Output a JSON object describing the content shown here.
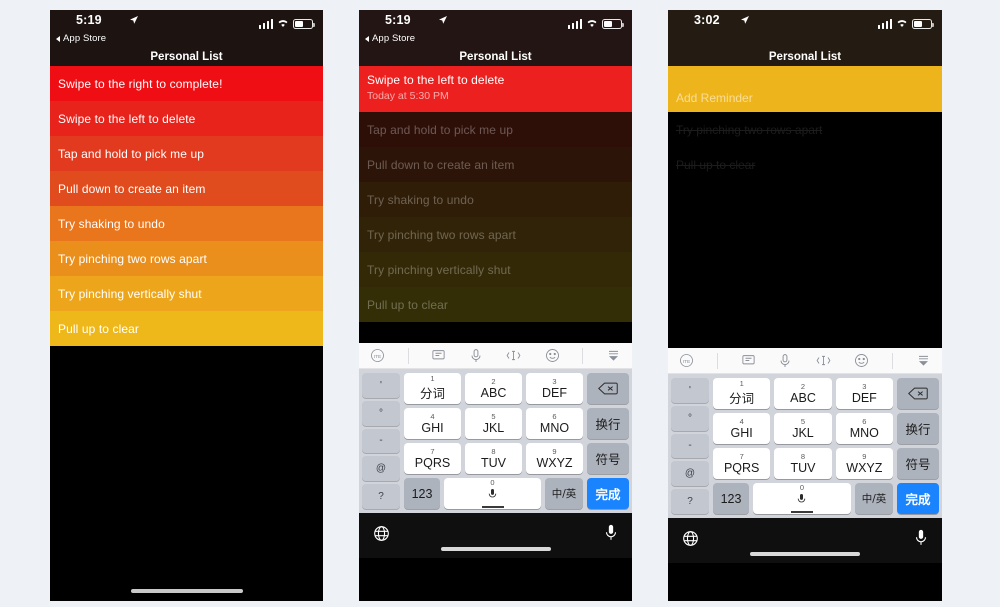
{
  "page": {
    "background_color": "#eef1f5",
    "panel_count": 3
  },
  "panels": [
    {
      "id": "panel-1",
      "status_bar": {
        "time": "5:19",
        "location_arrow": "location-arrow-icon",
        "signal": "signal-bars-icon",
        "wifi": "wifi-icon",
        "battery": "battery-icon"
      },
      "back_link": "App Store",
      "nav_title": "Personal List",
      "rows": [
        {
          "text": "Swipe to the right to complete!",
          "color": "#ef0e14"
        },
        {
          "text": "Swipe to the left to delete",
          "color": "#e8231c"
        },
        {
          "text": "Tap and hold to pick me up",
          "color": "#e23a1f"
        },
        {
          "text": "Pull down to create an item",
          "color": "#e04c1d"
        },
        {
          "text": "Try shaking to undo",
          "color": "#e9751c"
        },
        {
          "text": "Try pinching two rows apart",
          "color": "#eb8f1c"
        },
        {
          "text": "Try pinching vertically shut",
          "color": "#eda61b"
        },
        {
          "text": "Pull up to clear",
          "color": "#efb81a"
        }
      ]
    },
    {
      "id": "panel-2",
      "status_bar": {
        "time": "5:19",
        "location_arrow": "location-arrow-icon",
        "signal": "signal-bars-icon",
        "wifi": "wifi-icon",
        "battery": "battery-icon"
      },
      "back_link": "App Store",
      "nav_title": "Personal List",
      "focused_row": {
        "text": "Swipe to the left to delete",
        "subtitle": "Today at 5:30 PM",
        "color": "#ed2020"
      },
      "dimmed_rows": [
        {
          "text": "Tap and hold to pick me up",
          "color": "#2d0f08"
        },
        {
          "text": "Pull down to create an item",
          "color": "#2d1408"
        },
        {
          "text": "Try shaking to undo",
          "color": "#2f1d07"
        },
        {
          "text": "Try pinching two rows apart",
          "color": "#312307"
        },
        {
          "text": "Try pinching vertically shut",
          "color": "#332906"
        },
        {
          "text": "Pull up to clear",
          "color": "#342e06"
        }
      ]
    },
    {
      "id": "panel-3",
      "status_bar": {
        "time": "3:02",
        "location_arrow": "location-arrow-icon",
        "signal": "signal-bars-icon",
        "wifi": "wifi-icon",
        "battery": "battery-icon"
      },
      "back_link": "",
      "nav_title": "Personal List",
      "add_row": {
        "text": "Add Reminder",
        "color": "#eeb41c"
      },
      "completed_rows": [
        {
          "text": "Try pinching two rows apart"
        },
        {
          "text": "Pull up to clear"
        }
      ]
    }
  ],
  "keyboard": {
    "toolbar": [
      "sogou-logo-icon",
      "chat-bubble-icon",
      "microphone-icon",
      "text-cursor-icon",
      "emoji-smiley-icon",
      "dismiss-keyboard-icon"
    ],
    "side_keys": [
      "'",
      "°",
      "-",
      "@",
      "?"
    ],
    "keys": [
      {
        "num": "1",
        "label": "分词"
      },
      {
        "num": "2",
        "label": "ABC"
      },
      {
        "num": "3",
        "label": "DEF"
      },
      {
        "num": "4",
        "label": "GHI"
      },
      {
        "num": "5",
        "label": "JKL"
      },
      {
        "num": "6",
        "label": "MNO"
      },
      {
        "num": "7",
        "label": "PQRS"
      },
      {
        "num": "8",
        "label": "TUV"
      },
      {
        "num": "9",
        "label": "WXYZ"
      }
    ],
    "right_keys": [
      {
        "label": "backspace-icon",
        "type": "icon"
      },
      {
        "label": "换行",
        "type": "text"
      },
      {
        "label": "符号",
        "type": "text"
      }
    ],
    "bottom_row": {
      "numbers_key": "123",
      "space_num": "0",
      "language_key": "中/英",
      "done_key": "完成",
      "done_color": "#1a84ff"
    },
    "bottom_bar": {
      "globe": "globe-icon",
      "mic": "microphone-icon"
    }
  }
}
